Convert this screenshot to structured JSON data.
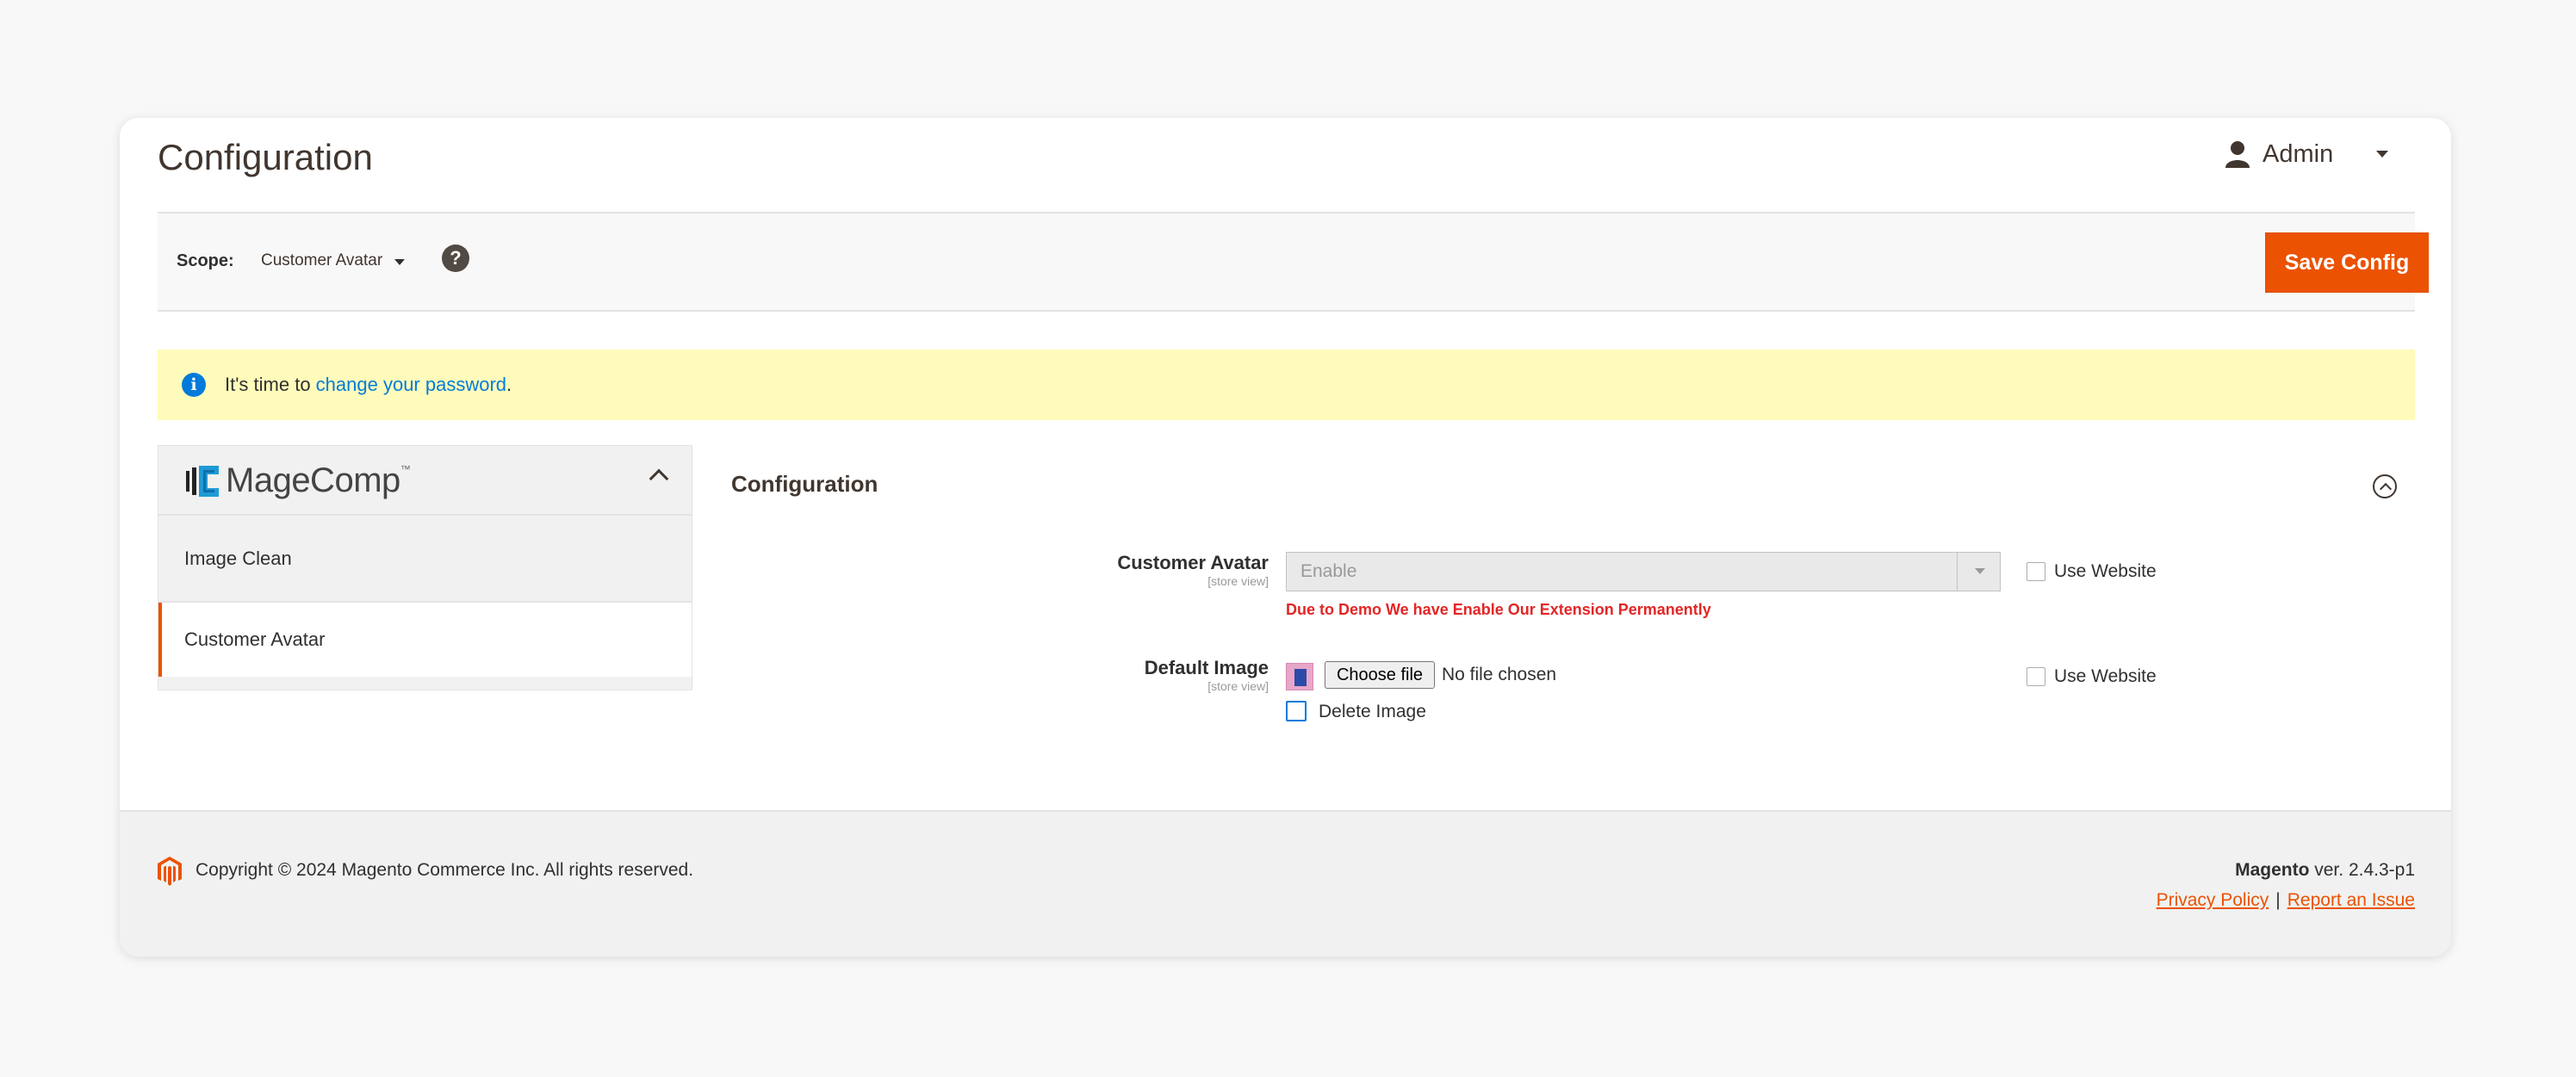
{
  "header": {
    "page_title": "Configuration",
    "user_name": "Admin"
  },
  "scope": {
    "label": "Scope:",
    "value": "Customer Avatar",
    "help": "?"
  },
  "toolbar": {
    "save_label": "Save Config"
  },
  "notice": {
    "prefix": "It's time to ",
    "link": "change your password",
    "suffix": "."
  },
  "sidebar": {
    "brand": "MageComp",
    "trademark": "™",
    "items": [
      {
        "label": "Image Clean",
        "active": false
      },
      {
        "label": "Customer Avatar",
        "active": true
      }
    ]
  },
  "section": {
    "title": "Configuration",
    "fields": [
      {
        "label": "Customer Avatar",
        "scope": "[store view]",
        "value": "Enable",
        "note": "Due to Demo We have Enable Our Extension Permanently",
        "use_website": "Use Website"
      },
      {
        "label": "Default Image",
        "scope": "[store view]",
        "file_button": "Choose file",
        "file_status": "No file chosen",
        "delete_label": "Delete Image",
        "use_website": "Use Website"
      }
    ]
  },
  "footer": {
    "copyright": "Copyright © 2024 Magento Commerce Inc. All rights reserved.",
    "product": "Magento",
    "version": " ver. 2.4.3-p1",
    "privacy": "Privacy Policy",
    "separator": "|",
    "report": "Report an Issue"
  },
  "colors": {
    "accent": "#eb5202",
    "link": "#007bdb",
    "notice_bg": "#fffbbb",
    "warning": "#e22626"
  },
  "icons": [
    "user-icon",
    "help-icon",
    "info-icon",
    "magecomp-logo",
    "chevron-up-icon",
    "collapse-circle-icon",
    "magento-logo"
  ]
}
